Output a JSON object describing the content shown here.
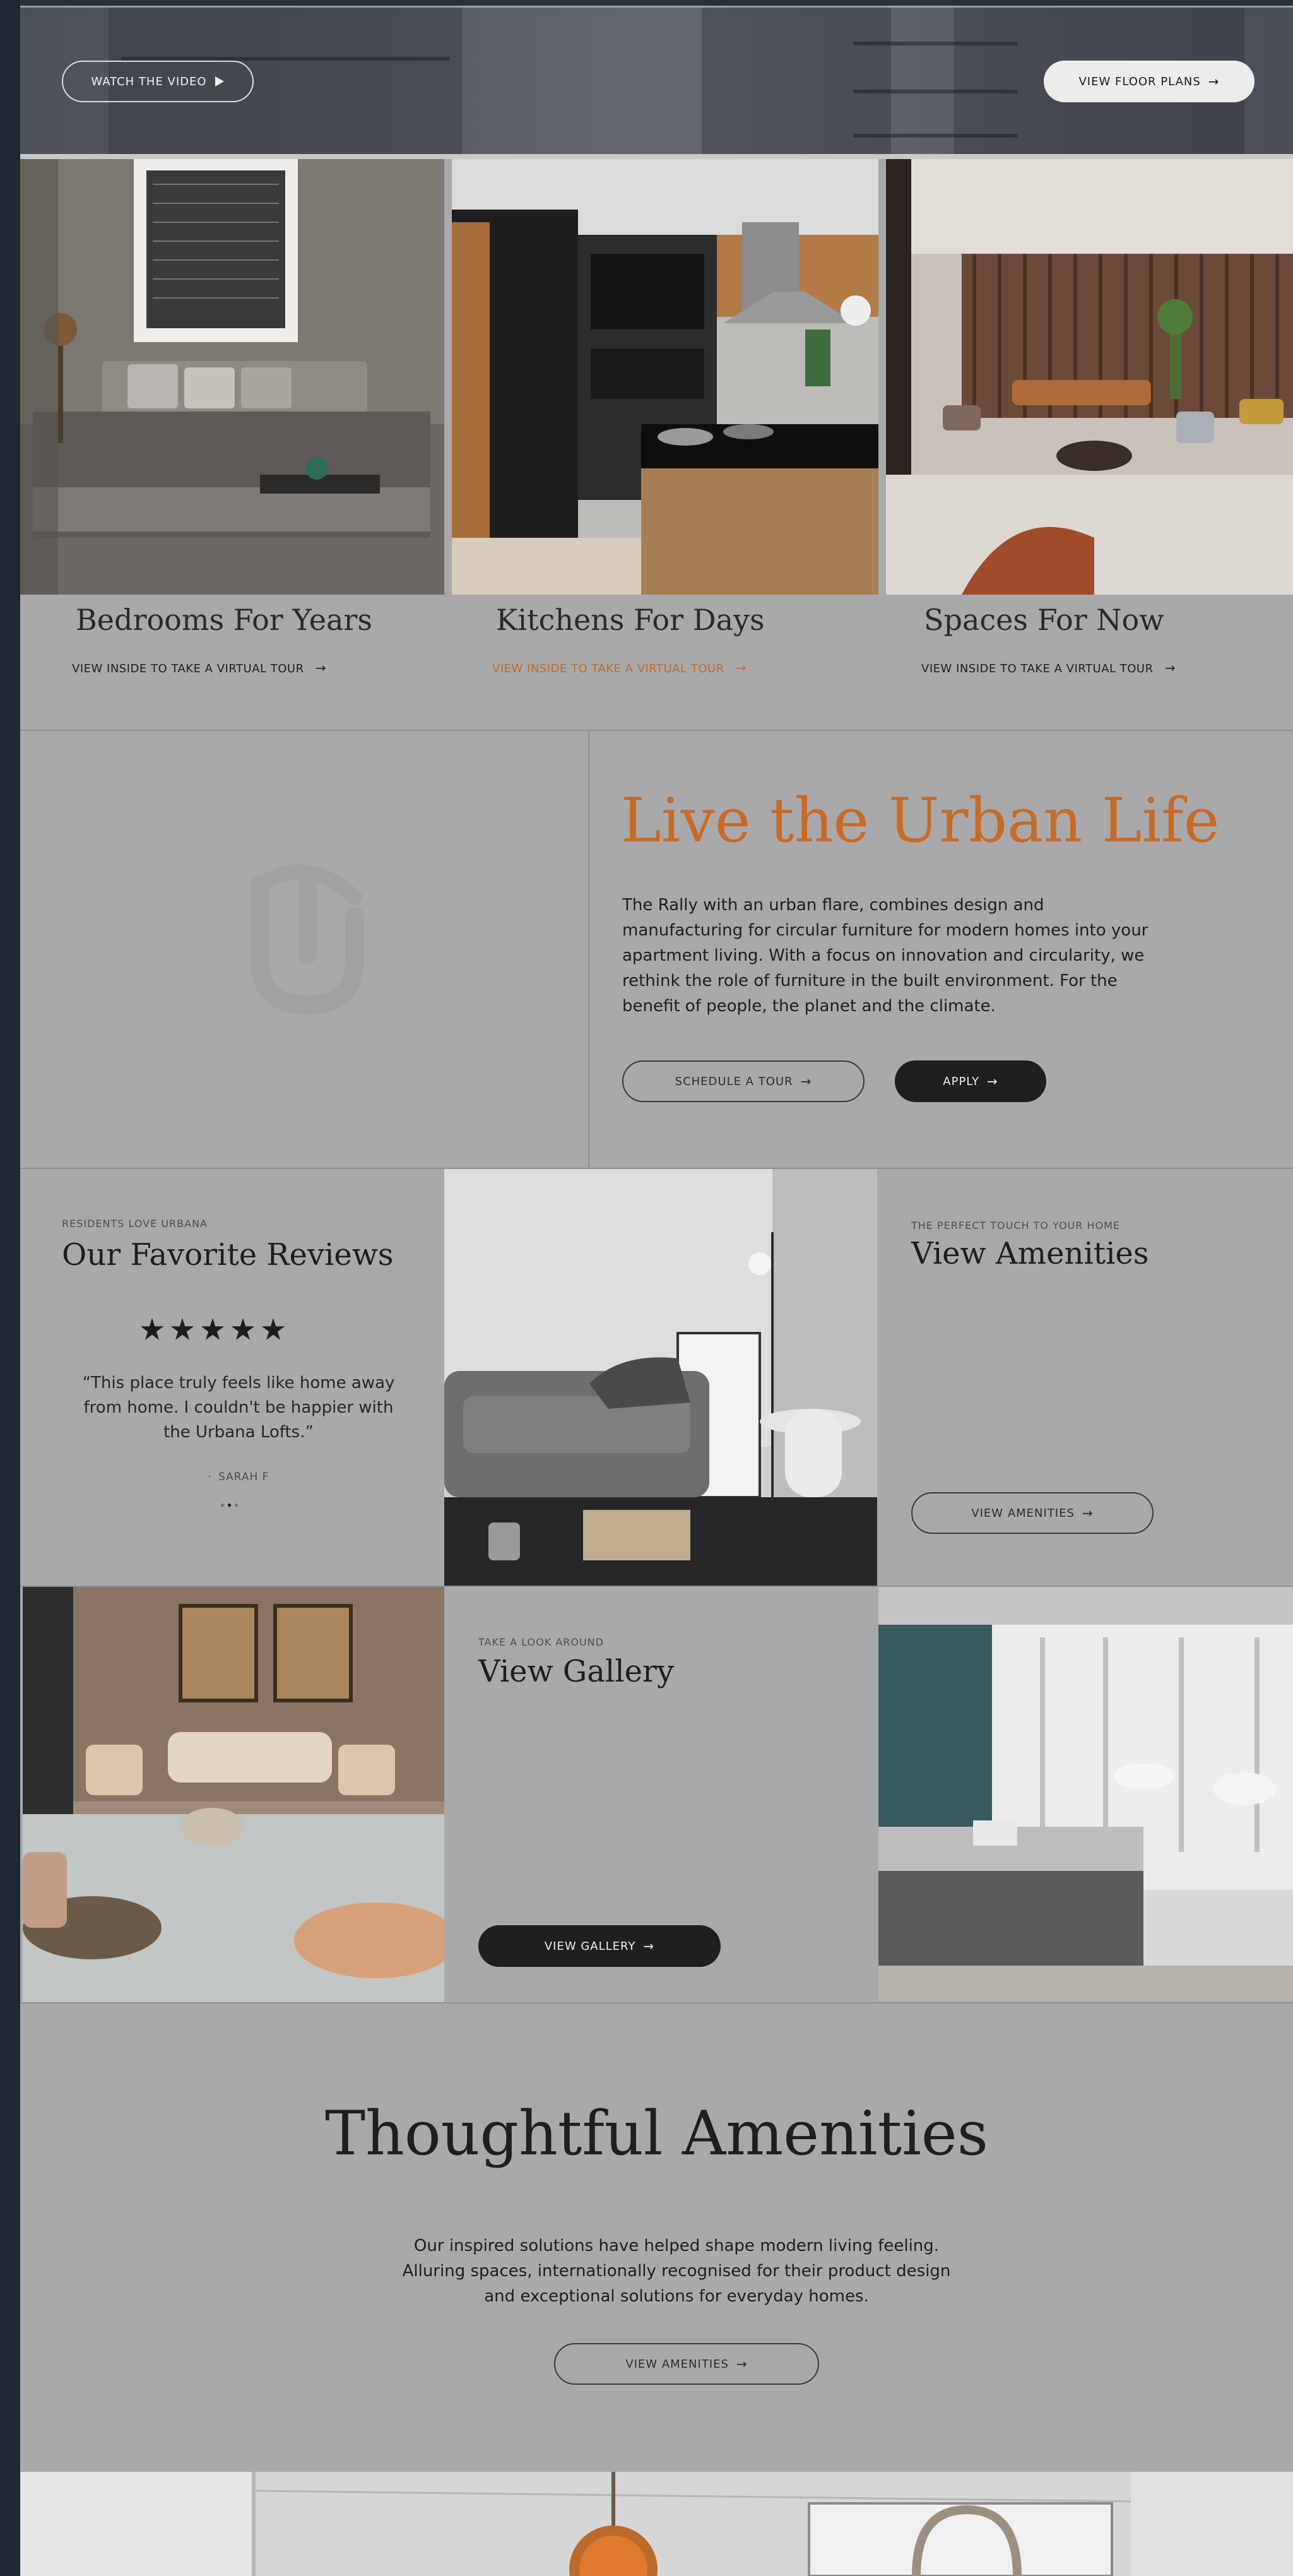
{
  "hero": {
    "watch_video_label": "WATCH THE VIDEO",
    "floor_plans_label": "VIEW FLOOR PLANS"
  },
  "rooms": [
    {
      "title": "Bedrooms For Years",
      "link": "VIEW INSIDE TO TAKE A VIRTUAL TOUR",
      "link_color": "#1e1e20"
    },
    {
      "title": "Kitchens For Days",
      "link": "VIEW INSIDE TO TAKE A VIRTUAL TOUR",
      "link_color": "#c86a25"
    },
    {
      "title": "Spaces For Now",
      "link": "VIEW INSIDE TO TAKE A VIRTUAL TOUR",
      "link_color": "#1e1e20"
    }
  ],
  "urban": {
    "title": "Live the Urban Life",
    "body": "The Rally with an urban flare, combines design and manufacturing for circular furniture for modern homes into your apartment living. With a focus on innovation and circularity, we rethink the role of furniture in the built environment. For the benefit of people, the planet and the climate.",
    "schedule_label": "SCHEDULE A TOUR",
    "apply_label": "APPLY"
  },
  "reviews": {
    "eyebrow": "RESIDENTS LOVE URBANA",
    "title": "Our Favorite Reviews",
    "rating": 5,
    "quote": "“This place truly feels like home away from home. I couldn't be happier with the Urbana Lofts.”",
    "author": "SARAH F"
  },
  "amenities_card": {
    "eyebrow": "THE PERFECT TOUCH TO YOUR HOME",
    "title": "View Amenities",
    "button_label": "VIEW AMENITIES"
  },
  "gallery_card": {
    "eyebrow": "TAKE A LOOK AROUND",
    "title": "View Gallery",
    "button_label": "VIEW GALLERY"
  },
  "thoughtful": {
    "title": "Thoughtful Amenities",
    "body": "Our inspired solutions have helped shape modern living feeling. Alluring spaces, internationally recognised for their product design and exceptional solutions for everyday homes.",
    "button_label": "VIEW AMENITIES"
  },
  "colors": {
    "accent": "#c76a26",
    "page_background": "#a9a9ab",
    "dark_button": "#1e1f21"
  },
  "icons": {
    "play": "play-icon",
    "arrow": "arrow-right-icon",
    "star": "star-icon",
    "logo": "urbana-logo-mark"
  }
}
